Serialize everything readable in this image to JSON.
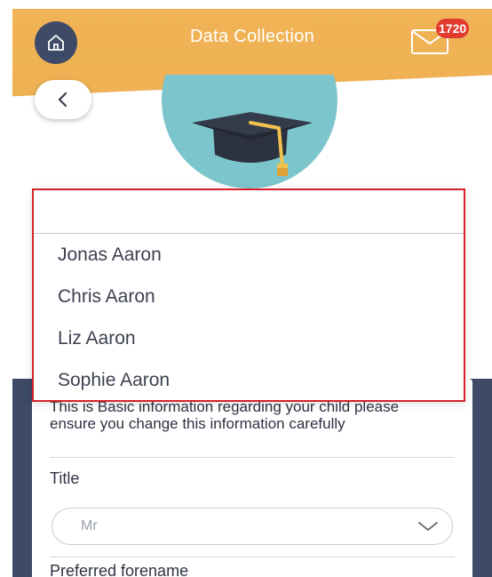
{
  "header": {
    "title": "Data Collection",
    "mail_badge_count": "1720"
  },
  "dropdown": {
    "search_value": "",
    "options": [
      "Jonas Aaron",
      "Chris Aaron",
      "Liz Aaron",
      "Sophie Aaron"
    ]
  },
  "form": {
    "info_text": "This is Basic information regarding your child please ensure you change this information carefully",
    "title_label": "Title",
    "title_value": "Mr",
    "preferred_forename_label": "Preferred forename"
  },
  "colors": {
    "header_accent": "#f0b356",
    "navy": "#3d4a68",
    "avatar_teal": "#7cc5cc",
    "badge_red": "#e23a2e",
    "highlight_red": "#d9202a"
  },
  "icons": {
    "home": "home-icon",
    "mail": "mail-icon",
    "back": "chevron-left-icon",
    "avatar": "graduation-cap-icon",
    "select": "chevron-down-icon"
  }
}
